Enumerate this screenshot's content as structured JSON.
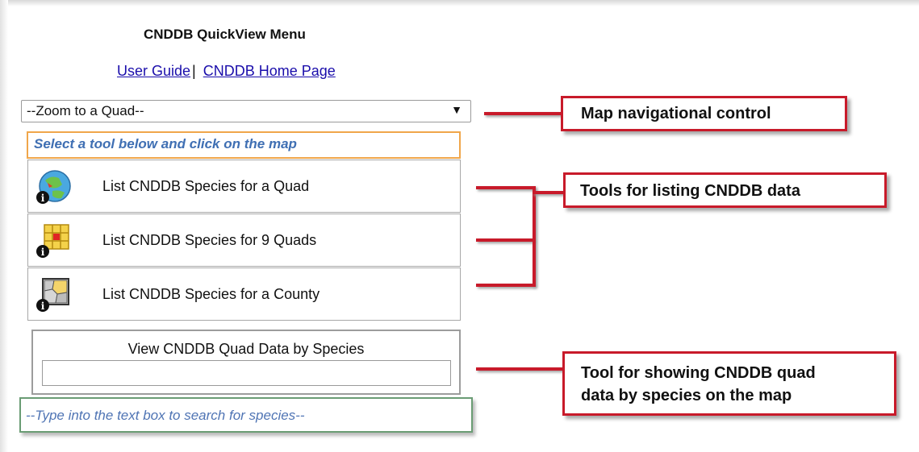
{
  "menu": {
    "title": "CNDDB QuickView Menu",
    "links": [
      "User Guide",
      "CNDDB Home Page"
    ],
    "separator": "|",
    "zoom_select": {
      "selected": "--Zoom to a Quad--",
      "arrow": "▼"
    },
    "tool_hint": "Select a tool below and click on the map",
    "tools": [
      {
        "label": "List CNDDB Species for a Quad",
        "icon": "globe-info-icon"
      },
      {
        "label": "List CNDDB Species for 9 Quads",
        "icon": "nine-grid-info-icon"
      },
      {
        "label": "List CNDDB Species for a County",
        "icon": "county-map-info-icon"
      }
    ],
    "species_search": {
      "label": "View CNDDB Quad Data by Species",
      "value": "",
      "hint": "--Type into the text box to search for species--"
    }
  },
  "callouts": {
    "navigation": "Map navigational control",
    "listing": "Tools for listing CNDDB data",
    "species_line1": "Tool for showing CNDDB quad",
    "species_line2": "data by species on the map"
  },
  "colors": {
    "callout_border": "#c81a2a",
    "hint_border": "#f0a64a",
    "search_hint_border": "#6a9c74",
    "link": "#1a0dab"
  }
}
